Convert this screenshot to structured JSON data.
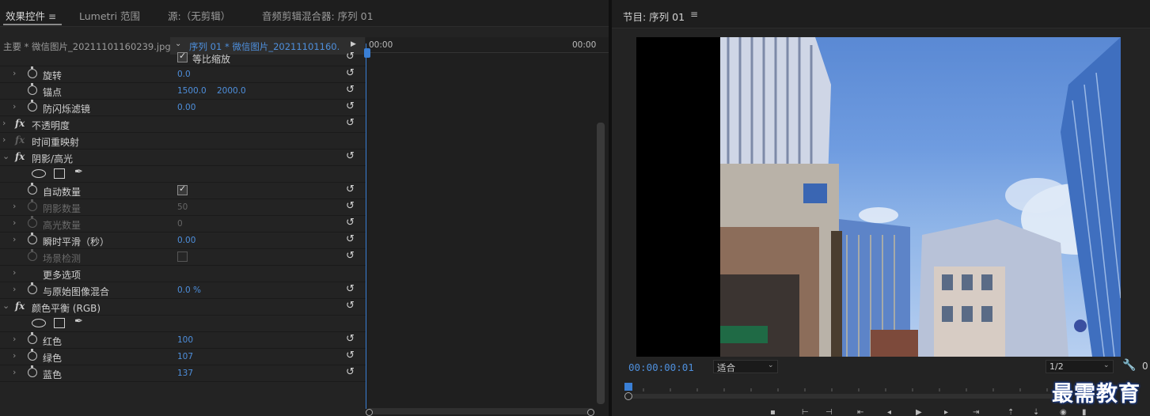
{
  "left_tabs": {
    "effects": "效果控件",
    "lumetri": "Lumetri 范围",
    "source": "源:（无剪辑）",
    "mixer": "音频剪辑混合器: 序列 01"
  },
  "source_bar": {
    "master": "主要 * 微信图片_20211101160239.jpg",
    "sequence": "序列 01 * 微信图片_20211101160..."
  },
  "timeline": {
    "start": "00:00",
    "end": "00:00"
  },
  "rows": {
    "uniform_scale": "等比缩放",
    "rotation": {
      "label": "旋转",
      "value": "0.0"
    },
    "anchor": {
      "label": "锚点",
      "x": "1500.0",
      "y": "2000.0"
    },
    "antiflicker": {
      "label": "防闪烁滤镜",
      "value": "0.00"
    },
    "opacity": "不透明度",
    "time_remap": "时间重映射",
    "shadow_highlight": "阴影/高光",
    "auto_amount": "自动数量",
    "shadow_amount": {
      "label": "阴影数量",
      "value": "50"
    },
    "highlight_amount": {
      "label": "高光数量",
      "value": "0"
    },
    "temporal_smooth": {
      "label": "瞬时平滑（秒）",
      "value": "0.00"
    },
    "scene_detect": "场景检测",
    "more_options": "更多选项",
    "blend": {
      "label": "与原始图像混合",
      "value": "0.0 %"
    },
    "color_balance": "颜色平衡 (RGB)",
    "red": {
      "label": "红色",
      "value": "100"
    },
    "green": {
      "label": "绿色",
      "value": "107"
    },
    "blue": {
      "label": "蓝色",
      "value": "137"
    }
  },
  "program": {
    "title": "节目: 序列 01",
    "timecode": "00:00:00:01",
    "fit": "适合",
    "resolution": "1/2",
    "zoom_right": "0"
  },
  "watermark": "最需教育",
  "icons": {
    "menu": "hamburger-icon",
    "stopwatch": "stopwatch-icon",
    "reset": "reset-icon",
    "wrench": "wrench-icon"
  },
  "colors": {
    "accent_blue": "#4e8fdc",
    "panel": "#232323"
  }
}
